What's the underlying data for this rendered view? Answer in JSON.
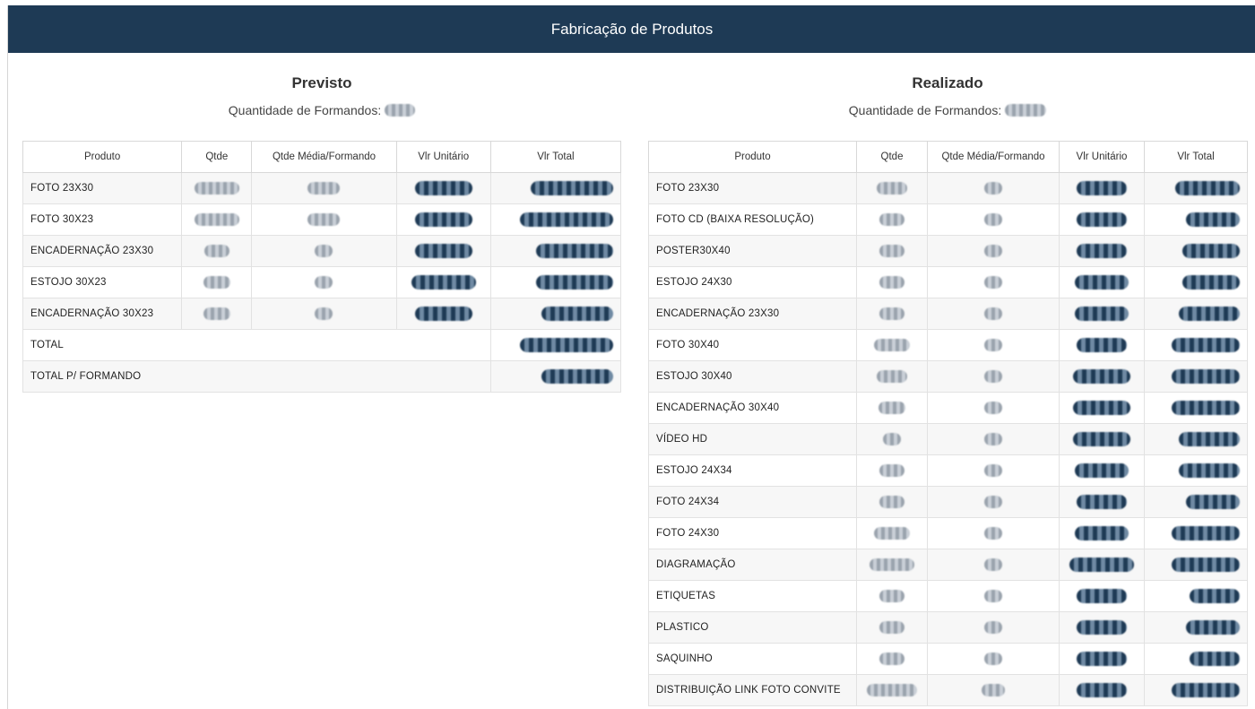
{
  "header": {
    "title": "Fabricação de Produtos"
  },
  "previsto": {
    "title": "Previsto",
    "qty_label": "Quantidade de Formandos:",
    "columns": [
      "Produto",
      "Qtde",
      "Qtde Média/Formando",
      "Vlr Unitário",
      "Vlr Total"
    ],
    "rows": [
      {
        "produto": "FOTO 23X30"
      },
      {
        "produto": "FOTO 30X23"
      },
      {
        "produto": "ENCADERNAÇÃO 23X30"
      },
      {
        "produto": "ESTOJO 30X23"
      },
      {
        "produto": "ENCADERNAÇÃO 30X23"
      }
    ],
    "total_label": "TOTAL",
    "total_per_label": "TOTAL P/ FORMANDO"
  },
  "realizado": {
    "title": "Realizado",
    "qty_label": "Quantidade de Formandos:",
    "columns": [
      "Produto",
      "Qtde",
      "Qtde Média/Formando",
      "Vlr Unitário",
      "Vlr Total"
    ],
    "rows": [
      {
        "produto": "FOTO 23X30"
      },
      {
        "produto": "FOTO CD (BAIXA RESOLUÇÃO)"
      },
      {
        "produto": "POSTER30X40"
      },
      {
        "produto": "ESTOJO 24X30"
      },
      {
        "produto": "ENCADERNAÇÃO 23X30"
      },
      {
        "produto": "FOTO 30X40"
      },
      {
        "produto": "ESTOJO 30X40"
      },
      {
        "produto": "ENCADERNAÇÃO 30X40"
      },
      {
        "produto": "VÍDEO HD"
      },
      {
        "produto": "ESTOJO 24X34"
      },
      {
        "produto": "FOTO 24X34"
      },
      {
        "produto": "FOTO 24X30"
      },
      {
        "produto": "DIAGRAMAÇÃO"
      },
      {
        "produto": "ETIQUETAS"
      },
      {
        "produto": "PLASTICO"
      },
      {
        "produto": "SAQUINHO"
      },
      {
        "produto": "DISTRIBUIÇÃO LINK FOTO CONVITE"
      }
    ]
  }
}
